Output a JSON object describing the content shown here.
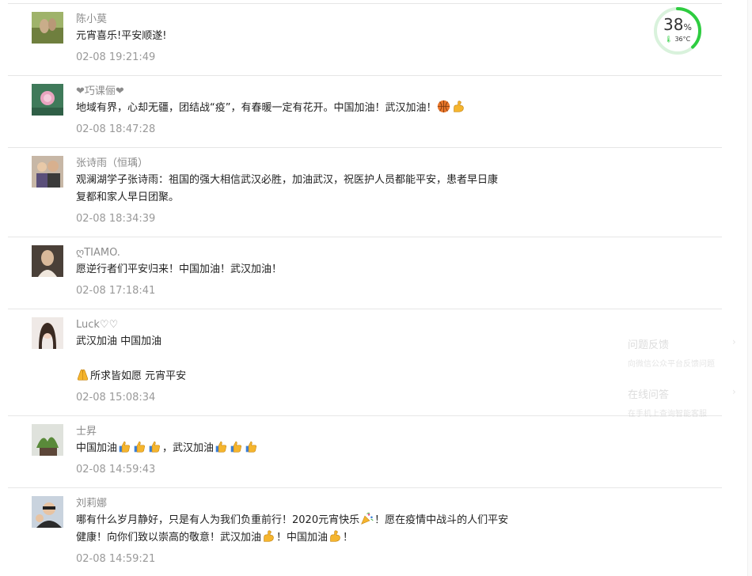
{
  "comments": [
    {
      "name": "陈小莫",
      "lines": [
        "元宵喜乐!平安顺遂!"
      ],
      "time": "02-08 19:21:49"
    },
    {
      "name": "❤巧课俪❤",
      "lines": [
        "地域有界，心却无疆，团结战“疫”，有春暖一定有花开。中国加油！武汉加油！"
      ],
      "time": "02-08 18:47:28",
      "emoji": [
        "basketball-icon",
        "flexed-biceps-icon"
      ]
    },
    {
      "name": "张诗雨（恒瑀）",
      "lines": [
        "观澜湖学子张诗雨：祖国的强大相信武汉必胜，加油武汉，祝医护人员都能平安，患者早日康",
        "复都和家人早日团聚。"
      ],
      "time": "02-08 18:34:39"
    },
    {
      "name": "ღTIAMO.",
      "lines": [
        "愿逆行者们平安归来！中国加油！武汉加油！"
      ],
      "time": "02-08 17:18:41"
    },
    {
      "name": "Luck♡♡",
      "lines": [
        "武汉加油 中国加油",
        "",
        "所求皆如愿 元宵平安"
      ],
      "time": "02-08 15:08:34"
    },
    {
      "name": "士昇",
      "lines": [
        "中国加油",
        "，武汉加油"
      ],
      "time": "02-08 14:59:43"
    },
    {
      "name": "刘莉娜",
      "lines": [
        "哪有什么岁月静好，只是有人为我们负重前行！2020元宵快乐",
        "！愿在疫情中战斗的人们平安",
        "健康！向你们致以崇高的敬意！武汉加油",
        "！中国加油",
        "！"
      ],
      "time": "02-08 14:59:21"
    }
  ],
  "gauge": {
    "value": "38",
    "unit": "%",
    "progress": 0.38,
    "temp": "36°C",
    "color": "#2ecc40"
  },
  "feedback": {
    "item1_title": "问题反馈",
    "item1_sub": "向微信公众平台反馈问题",
    "item2_title": "在线问答",
    "item2_sub": "在手机上查询智能客服",
    "arrow": "›"
  }
}
